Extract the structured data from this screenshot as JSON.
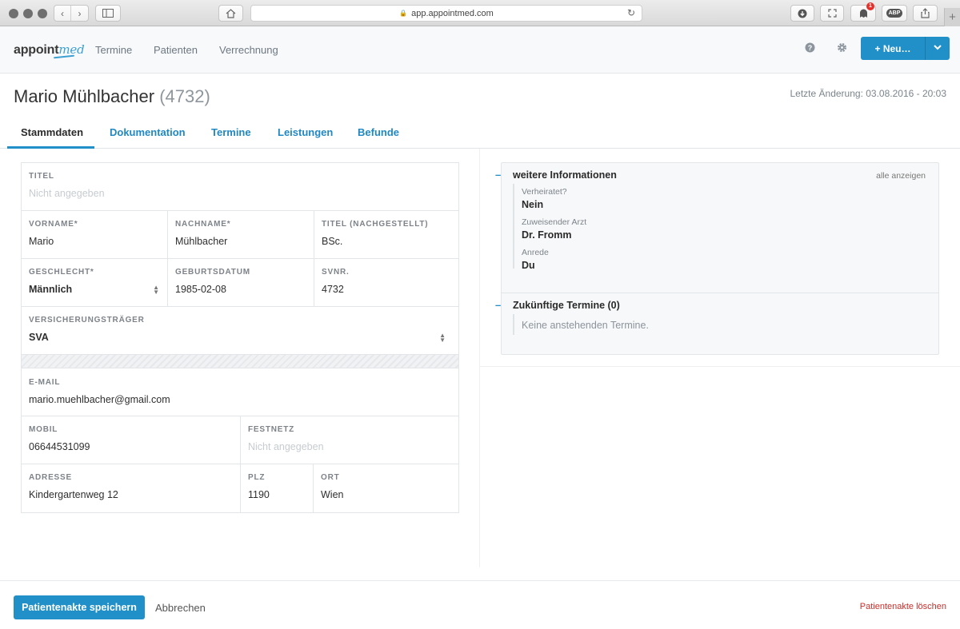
{
  "browser": {
    "url": "app.appointmed.com",
    "notification_count": "1",
    "adblock_label": "ABP"
  },
  "navbar": {
    "logo_main": "appoint",
    "logo_accent": "med",
    "links": [
      "Termine",
      "Patienten",
      "Verrechnung"
    ],
    "help_icon": "help-circle-icon",
    "settings_icon": "gear-icon",
    "new_button_label": "+ Neu…",
    "brand_color": "#2190c9"
  },
  "patient": {
    "name": "Mario Mühlbacher",
    "id_display": "(4732)",
    "last_change": "Letzte Änderung: 03.08.2016 - 20:03"
  },
  "tabs": [
    "Stammdaten",
    "Dokumentation",
    "Termine",
    "Leistungen",
    "Befunde"
  ],
  "form": {
    "titel": {
      "label": "TITEL",
      "value": "Nicht angegeben"
    },
    "vorname": {
      "label": "VORNAME*",
      "value": "Mario"
    },
    "nachname": {
      "label": "NACHNAME*",
      "value": "Mühlbacher"
    },
    "titel_nach": {
      "label": "TITEL (NACHGESTELLT)",
      "value": "BSc."
    },
    "geschlecht": {
      "label": "GESCHLECHT*",
      "value": "Männlich"
    },
    "geburtsdatum": {
      "label": "GEBURTSDATUM",
      "value": "1985-02-08"
    },
    "svnr": {
      "label": "SVNR.",
      "value": "4732"
    },
    "versicherung": {
      "label": "VERSICHERUNGSTRÄGER",
      "value": "SVA"
    },
    "email": {
      "label": "E-MAIL",
      "value": "mario.muehlbacher@gmail.com"
    },
    "mobil": {
      "label": "MOBIL",
      "value": "06644531099"
    },
    "festnetz": {
      "label": "FESTNETZ",
      "value": "Nicht angegeben"
    },
    "adresse": {
      "label": "ADRESSE",
      "value": "Kindergartenweg 12"
    },
    "plz": {
      "label": "PLZ",
      "value": "1190"
    },
    "ort": {
      "label": "ORT",
      "value": "Wien"
    }
  },
  "info": {
    "toggle": "–",
    "title": "weitere Informationen",
    "show_all": "alle anzeigen",
    "items": [
      {
        "key": "Verheiratet?",
        "value": "Nein"
      },
      {
        "key": "Zuweisender Arzt",
        "value": "Dr. Fromm"
      },
      {
        "key": "Anrede",
        "value": "Du"
      }
    ],
    "future_title": "Zukünftige Termine (0)",
    "future_empty": "Keine anstehenden Termine."
  },
  "footer": {
    "save_label": "Patientenakte speichern",
    "cancel_label": "Abbrechen",
    "delete_label": "Patientenakte löschen"
  }
}
